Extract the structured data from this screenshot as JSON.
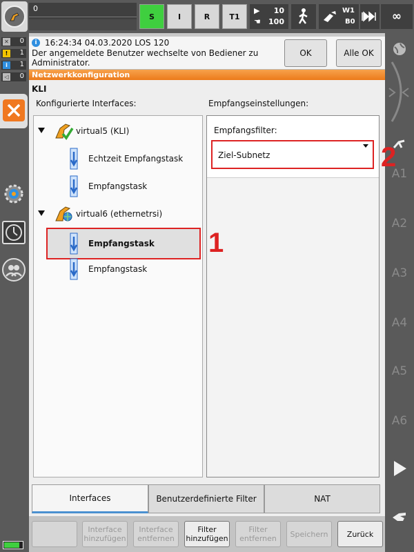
{
  "topbar": {
    "override_value": "0",
    "mode_s": "S",
    "mode_i": "I",
    "mode_r": "R",
    "mode_t1": "T1",
    "prog_override": "10",
    "hand_override": "100",
    "tool_w": "W1",
    "tool_b": "B0",
    "increment": "∞"
  },
  "counters": {
    "ack": "0",
    "warning": "1",
    "info": "1",
    "notify": "0"
  },
  "message": {
    "header": "16:24:34 04.03.2020 LOS 120",
    "text": "Der angemeldete Benutzer wechselte von Bediener zu Administrator.",
    "ok_label": "OK",
    "all_ok_label": "Alle OK"
  },
  "window_title": "Netzwerkkonfiguration",
  "main": {
    "section_label": "KLI",
    "configured_label": "Konfigurierte Interfaces:",
    "receive_label": "Empfangseinstellungen:",
    "tree": [
      {
        "type": "interface",
        "label": "virtual5 (KLI)"
      },
      {
        "type": "task",
        "label": "Echtzeit Empfangstask"
      },
      {
        "type": "task",
        "label": "Empfangstask"
      },
      {
        "type": "interface",
        "label": "virtual6 (ethernetrsi)"
      },
      {
        "type": "task",
        "label": "Empfangstask",
        "selected": true
      },
      {
        "type": "task",
        "label": "Empfangstask"
      }
    ],
    "filter_label": "Empfangsfilter:",
    "filter_value": "Ziel-Subnetz"
  },
  "callouts": [
    "1",
    "2"
  ],
  "tabs": [
    {
      "label": "Interfaces",
      "active": true
    },
    {
      "label": "Benutzerdefinierte Filter"
    },
    {
      "label": "NAT"
    }
  ],
  "softkeys": [
    {
      "label": "",
      "enabled": false
    },
    {
      "label": "Interface hinzufügen",
      "enabled": false
    },
    {
      "label": "Interface entfernen",
      "enabled": false
    },
    {
      "label": "Filter hinzufügen",
      "enabled": true
    },
    {
      "label": "Filter entfernen",
      "enabled": false
    },
    {
      "label": "Speichern",
      "enabled": false
    },
    {
      "label": "Zurück",
      "enabled": true
    }
  ],
  "axes": [
    "A1",
    "A2",
    "A3",
    "A4",
    "A5",
    "A6"
  ],
  "colors": {
    "accent_orange": "#ec7a1a",
    "mode_green": "#3fcf3f",
    "callout_red": "#d22222",
    "tab_active_blue": "#4a90d0"
  }
}
